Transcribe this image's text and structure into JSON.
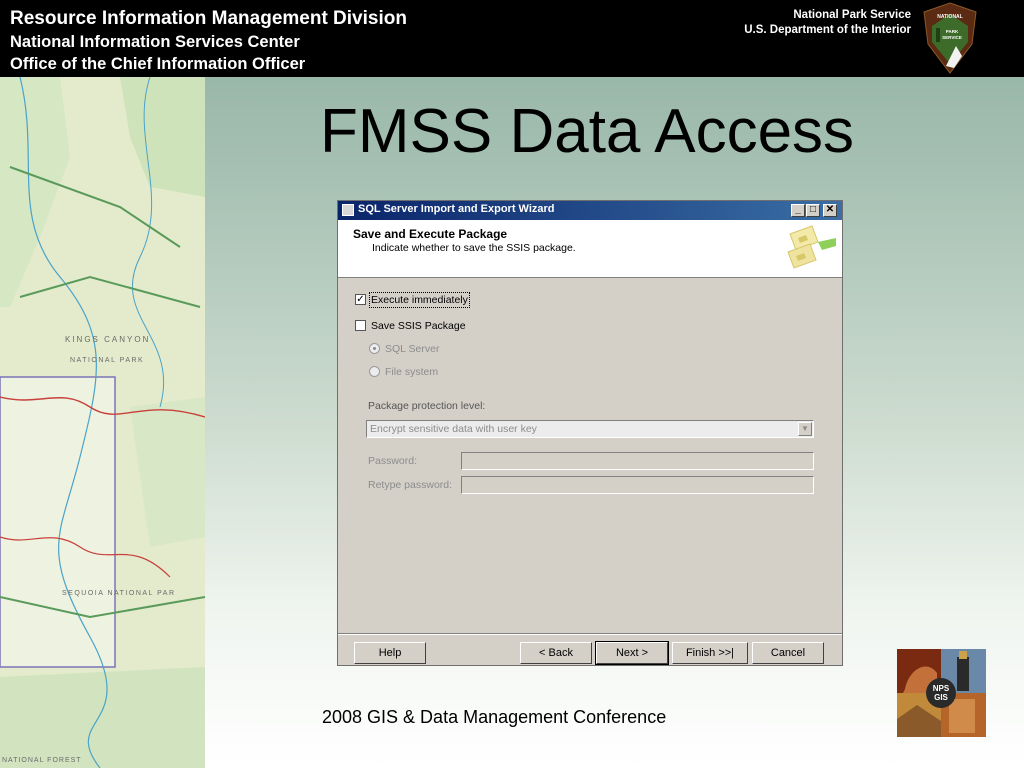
{
  "header": {
    "line1": "Resource Information Management Division",
    "line2": "National Information Services Center",
    "line3": "Office of the Chief Information Officer",
    "agency": "National Park Service",
    "department": "U.S. Department of the Interior",
    "logo_icon": "nps-arrowhead-logo",
    "logo_text": "NATIONAL PARK SERVICE"
  },
  "map": {
    "icon": "park-map-image",
    "labels": [
      "KINGS CANYON",
      "NATIONAL PARK",
      "SEQUOIA NATIONAL PAR",
      "NATIONAL FOREST"
    ]
  },
  "slide": {
    "title": "FMSS Data Access",
    "footer": "2008 GIS & Data Management Conference",
    "gis_logo_text": "NPS GIS"
  },
  "dialog": {
    "title": "SQL Server Import and Export Wizard",
    "header_title": "Save and Execute Package",
    "header_subtitle": "Indicate whether to save the SSIS package.",
    "execute_immediately": "Execute immediately",
    "execute_immediately_checked": true,
    "save_package": "Save SSIS Package",
    "save_package_checked": false,
    "radio_sql_server": "SQL Server",
    "radio_file_system": "File system",
    "protection_label": "Package protection level:",
    "protection_value": "Encrypt sensitive data with user key",
    "password_label": "Password:",
    "retype_label": "Retype password:",
    "buttons": {
      "help": "Help",
      "back": "< Back",
      "next": "Next >",
      "finish": "Finish >>|",
      "cancel": "Cancel"
    }
  },
  "colors": {
    "header_bg": "#000000",
    "titlebar": "#0a246a",
    "dialog_face": "#d4d0c8"
  }
}
